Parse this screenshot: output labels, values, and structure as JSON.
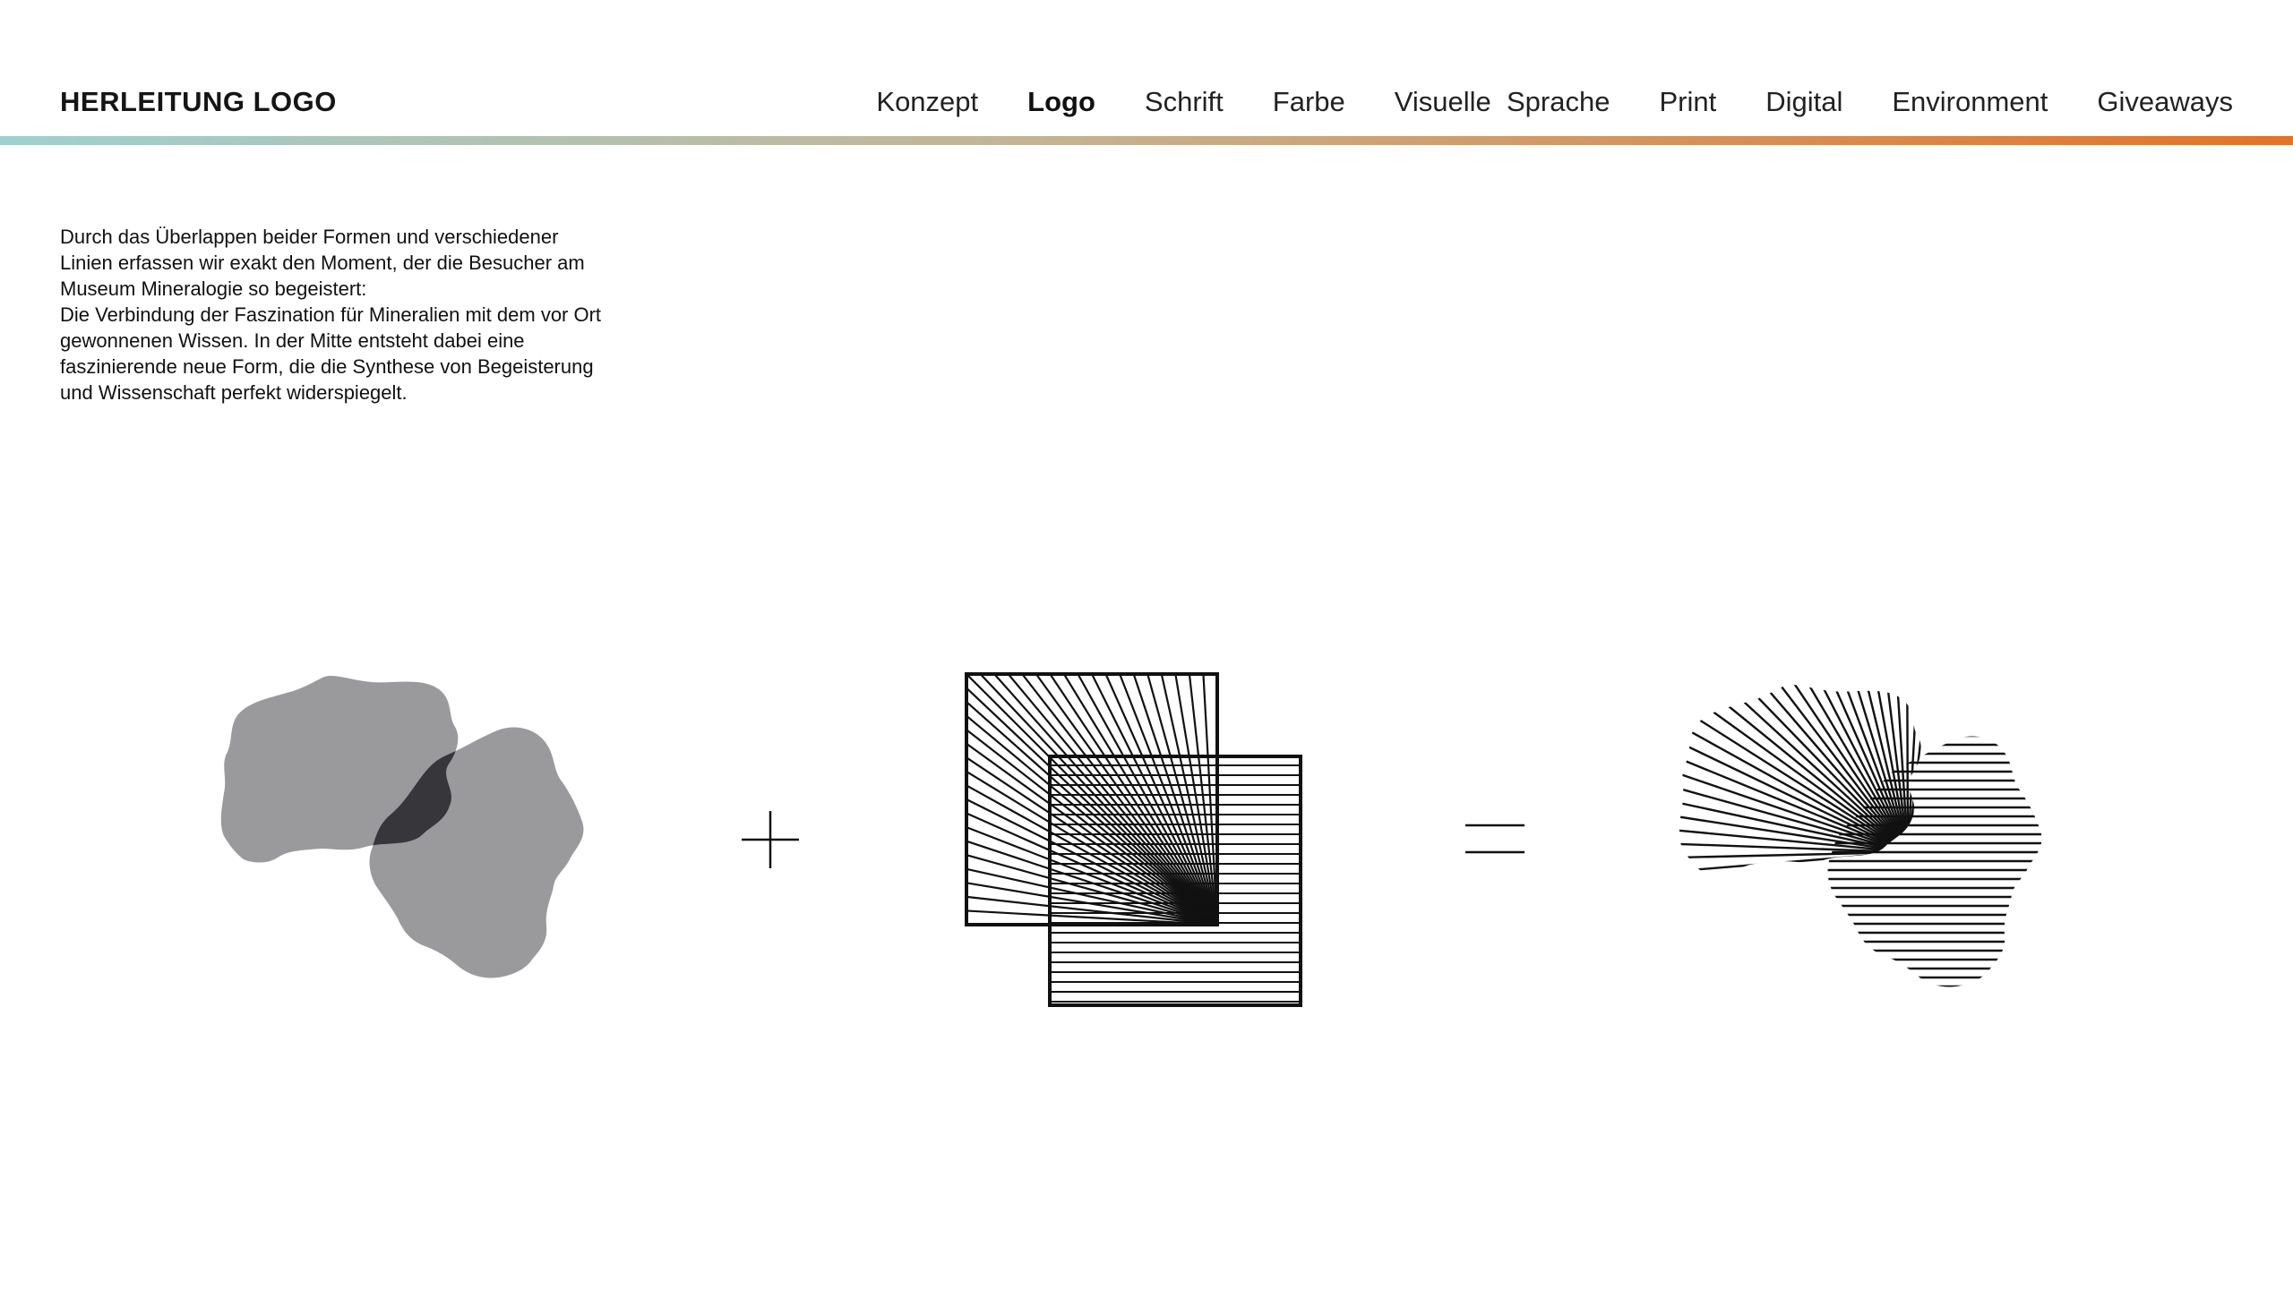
{
  "header": {
    "title": "HERLEITUNG LOGO",
    "nav": [
      {
        "label": "Konzept",
        "active": false
      },
      {
        "label": "Logo",
        "active": true
      },
      {
        "label": "Schrift",
        "active": false
      },
      {
        "label": "Farbe",
        "active": false
      },
      {
        "label": "Visuelle  Sprache",
        "active": false
      },
      {
        "label": "Print",
        "active": false
      },
      {
        "label": "Digital",
        "active": false
      },
      {
        "label": "Environment",
        "active": false
      },
      {
        "label": "Giveaways",
        "active": false
      }
    ],
    "gradient_colors": [
      "#9fd0cf",
      "#c4b494",
      "#e27327"
    ]
  },
  "intro": {
    "paragraph1": "Durch das Überlappen beider Formen und verschiedener Linien erfassen wir exakt den Moment, der die Besucher am Museum Mineralogie so begeistert:",
    "paragraph2": "Die Verbindung der Faszination für Mineralien mit dem vor Ort gewonnenen Wissen. In der Mitte entsteht dabei eine faszinierende neue Form, die die Synthese von Begeisterung und Wissenschaft perfekt widerspiegelt."
  },
  "equation": {
    "shapes_fill_light": "#9a999b",
    "shapes_fill_dark": "#37363b",
    "line_color": "#111111",
    "plus_icon": "plus-icon",
    "equals_icon": "equals-icon"
  }
}
